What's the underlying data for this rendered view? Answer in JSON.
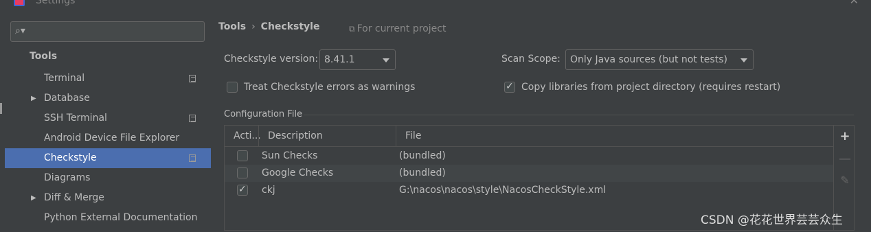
{
  "window": {
    "title": "Settings"
  },
  "search": {
    "placeholder": "",
    "value": ""
  },
  "sidebar": {
    "header": "Tools",
    "items": [
      {
        "label": "Terminal",
        "expandable": false,
        "copy": true,
        "selected": false
      },
      {
        "label": "Database",
        "expandable": true,
        "copy": false,
        "selected": false
      },
      {
        "label": "SSH Terminal",
        "expandable": false,
        "copy": true,
        "selected": false
      },
      {
        "label": "Android Device File Explorer",
        "expandable": false,
        "copy": false,
        "selected": false
      },
      {
        "label": "Checkstyle",
        "expandable": false,
        "copy": true,
        "selected": true
      },
      {
        "label": "Diagrams",
        "expandable": false,
        "copy": false,
        "selected": false
      },
      {
        "label": "Diff & Merge",
        "expandable": true,
        "copy": false,
        "selected": false
      },
      {
        "label": "Python External Documentation",
        "expandable": false,
        "copy": false,
        "selected": false
      }
    ]
  },
  "header": {
    "breadcrumb_parent": "Tools",
    "breadcrumb_sep": "›",
    "breadcrumb_current": "Checkstyle",
    "for_current_project": "For current project"
  },
  "settings": {
    "version_label": "Checkstyle version:",
    "version_value": "8.41.1",
    "scope_label": "Scan Scope:",
    "scope_value": "Only Java sources (but not tests)",
    "treat_errors_label": "Treat Checkstyle errors as warnings",
    "treat_errors_checked": false,
    "copy_libs_label": "Copy libraries from project directory (requires restart)",
    "copy_libs_checked": true
  },
  "config": {
    "section_title": "Configuration File",
    "columns": [
      "Acti...",
      "Description",
      "File"
    ],
    "rows": [
      {
        "active": false,
        "description": "Sun Checks",
        "file": "(bundled)"
      },
      {
        "active": false,
        "description": "Google Checks",
        "file": "(bundled)"
      },
      {
        "active": true,
        "description": "ckj",
        "file": "G:\\nacos\\nacos\\style\\NacosCheckStyle.xml"
      }
    ],
    "toolbar": {
      "add": "+",
      "remove": "—",
      "edit": "✎"
    }
  },
  "watermark": "CSDN @花花世界芸芸众生",
  "colors": {
    "background": "#3c3f41",
    "selection": "#4b6eaf",
    "text": "#bbbbbb",
    "border": "#646464"
  },
  "icons": {
    "search": "search-icon",
    "copy": "copy-settings-icon",
    "expand": "triangle-right-icon",
    "dropdown": "chevron-down-icon"
  }
}
